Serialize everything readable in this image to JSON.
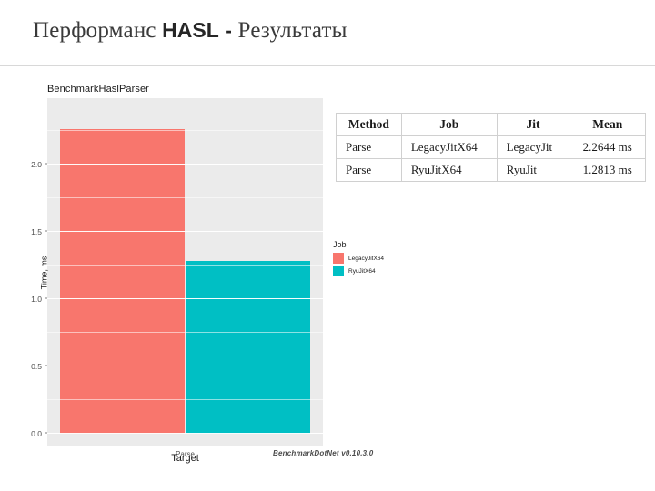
{
  "slide": {
    "title_prefix": "Перформанс",
    "title_brand": "HASL",
    "title_dash": "-",
    "title_suffix": "Результаты"
  },
  "table": {
    "headers": [
      "Method",
      "Job",
      "Jit",
      "Mean"
    ],
    "rows": [
      [
        "Parse",
        "LegacyJitX64",
        "LegacyJit",
        "2.2644 ms"
      ],
      [
        "Parse",
        "RyuJitX64",
        "RyuJit",
        "1.2813 ms"
      ]
    ]
  },
  "chart_data": {
    "type": "bar",
    "title": "BenchmarkHaslParser",
    "xlabel": "Target",
    "ylabel": "Time, ms",
    "categories": [
      "Parse"
    ],
    "series": [
      {
        "name": "LegacyJitX64",
        "values": [
          2.2644
        ],
        "color": "#F8766D"
      },
      {
        "name": "RyuJitX64",
        "values": [
          1.2813
        ],
        "color": "#00BFC4"
      }
    ],
    "ylim": [
      0,
      2.42
    ],
    "yticks": [
      0.0,
      0.5,
      1.0,
      1.5,
      2.0
    ],
    "ytick_labels": [
      "0.0",
      "0.5",
      "1.0",
      "1.5",
      "2.0"
    ],
    "xtick_labels": [
      "Parse"
    ],
    "legend": {
      "title": "Job",
      "position": "right",
      "entries": [
        "LegacyJitX64",
        "RyuJitX64"
      ]
    },
    "grid": true,
    "footer": "BenchmarkDotNet v0.10.3.0"
  }
}
